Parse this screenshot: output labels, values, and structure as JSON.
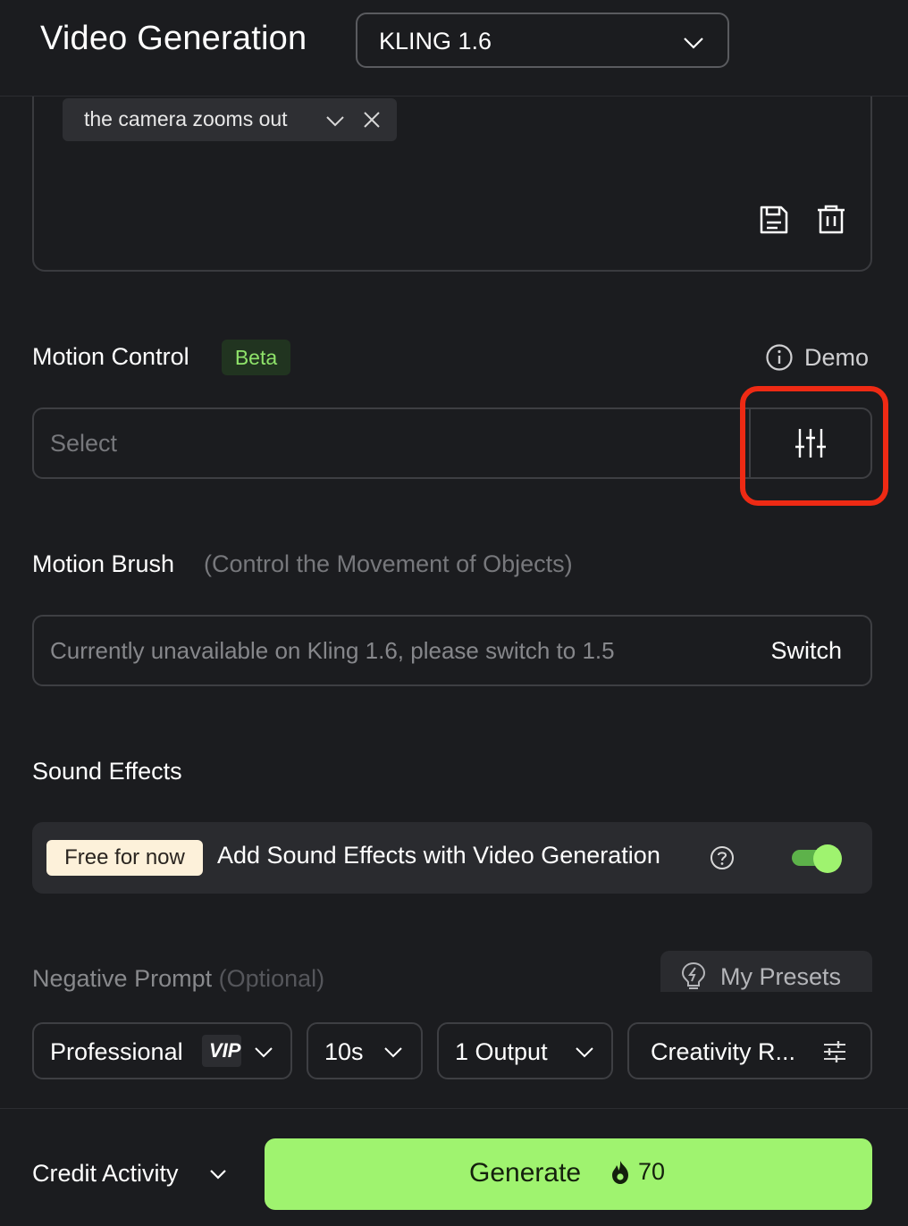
{
  "header": {
    "title": "Video Generation",
    "model_select": "KLING 1.6"
  },
  "prompt": {
    "tag_label": "the camera zooms out"
  },
  "motion_control": {
    "title": "Motion Control",
    "badge": "Beta",
    "demo_label": "Demo",
    "select_placeholder": "Select"
  },
  "motion_brush": {
    "title": "Motion Brush",
    "subtitle": "(Control the Movement of Objects)",
    "message": "Currently unavailable on Kling 1.6, please switch to 1.5",
    "switch_label": "Switch"
  },
  "sound_effects": {
    "title": "Sound Effects",
    "badge": "Free for now",
    "label": "Add Sound Effects with Video Generation",
    "enabled": true
  },
  "negative_prompt": {
    "title": "Negative Prompt",
    "optional": "(Optional)",
    "presets_label": "My Presets"
  },
  "options": {
    "mode": "Professional",
    "mode_badge": "VIP",
    "duration": "10s",
    "outputs": "1 Output",
    "creativity": "Creativity R..."
  },
  "footer": {
    "credit_activity": "Credit Activity",
    "generate_label": "Generate",
    "cost": "70"
  },
  "colors": {
    "accent_green": "#9ff36f",
    "highlight_red": "#ee2a14",
    "background": "#1b1c1f"
  }
}
